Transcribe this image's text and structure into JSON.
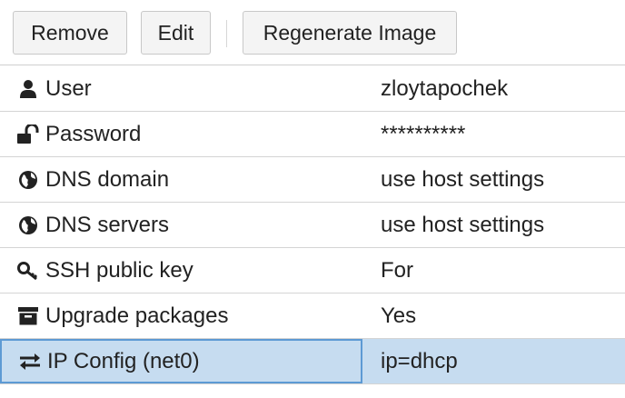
{
  "toolbar": {
    "remove_label": "Remove",
    "edit_label": "Edit",
    "regenerate_label": "Regenerate Image"
  },
  "rows": [
    {
      "icon": "user-icon",
      "key": "User",
      "value": "zloytapochek"
    },
    {
      "icon": "unlock-icon",
      "key": "Password",
      "value": "**********"
    },
    {
      "icon": "globe-icon",
      "key": "DNS domain",
      "value": "use host settings"
    },
    {
      "icon": "globe-icon",
      "key": "DNS servers",
      "value": "use host settings"
    },
    {
      "icon": "key-icon",
      "key": "SSH public key",
      "value": "For"
    },
    {
      "icon": "archive-icon",
      "key": "Upgrade packages",
      "value": "Yes"
    },
    {
      "icon": "exchange-icon",
      "key": "IP Config (net0)",
      "value": "ip=dhcp",
      "selected": true
    }
  ],
  "colors": {
    "selected_row": "#c6dcf0",
    "selected_border": "#5d9ad4"
  }
}
